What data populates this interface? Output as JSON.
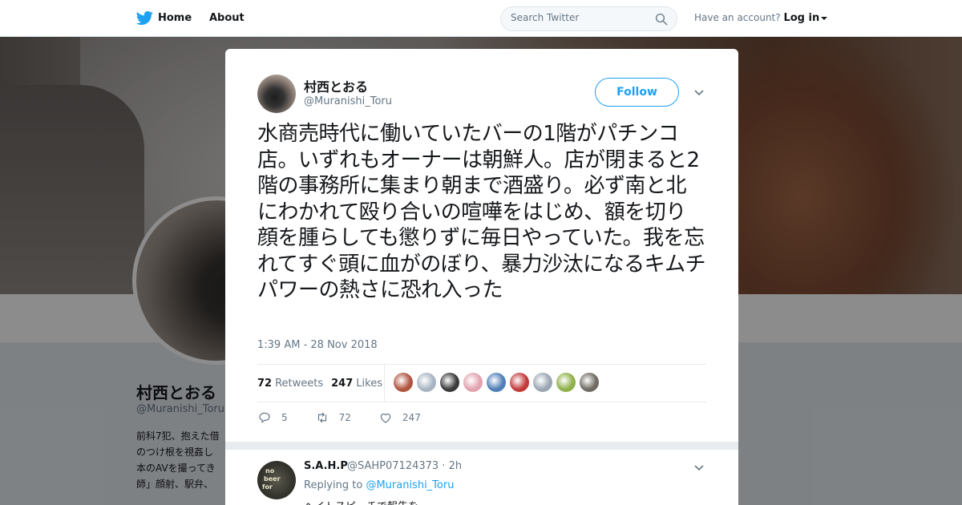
{
  "topbar": {
    "home_label": "Home",
    "about_label": "About",
    "search_placeholder": "Search Twitter",
    "account_prompt": "Have an account?",
    "login_label": "Log in"
  },
  "profile": {
    "name": "村西とおる",
    "handle": "@Muranishi_Toru",
    "bio_lines": [
      "前科7犯、抱えた借",
      "のつけ根を視姦し",
      "本のAVを撮ってき",
      "師」顔射、駅弁、"
    ]
  },
  "tweet": {
    "author_name": "村西とおる",
    "author_handle": "@Muranishi_Toru",
    "follow_label": "Follow",
    "text": "水商売時代に働いていたバーの1階がパチンコ店。いずれもオーナーは朝鮮人。店が閉まると2階の事務所に集まり朝まで酒盛り。必ず南と北にわかれて殴り合いの喧嘩をはじめ、額を切り顔を腫らしても懲りずに毎日やっていた。我を忘れてすぐ頭に血がのぼり、暴力沙汰になるキムチパワーの熱さに恐れ入った",
    "timestamp": "1:39 AM - 28 Nov 2018",
    "retweets_count": "72",
    "retweets_label": "Retweets",
    "likes_count": "247",
    "likes_label": "Likes",
    "reply_count": "5",
    "retweet_action_count": "72",
    "like_action_count": "247"
  },
  "reply": {
    "name": "S.A.H.P",
    "meta": "@SAHP07124373 · 2h",
    "replying_prefix": "Replying to",
    "replying_handle": "@Muranishi_Toru",
    "text": "ヘイトスピーチで報告を"
  },
  "colors": {
    "brand": "#1da1f2",
    "text": "#14171a",
    "muted": "#657786",
    "overlay": "rgba(0,0,0,0.45)"
  },
  "likers": [
    "#b0543e",
    "#a7b5c2",
    "#3a3a3a",
    "#e2a3b0",
    "#4f7fb8",
    "#c23b3b",
    "#9aa7b3",
    "#8fb04a",
    "#6f6a62"
  ]
}
